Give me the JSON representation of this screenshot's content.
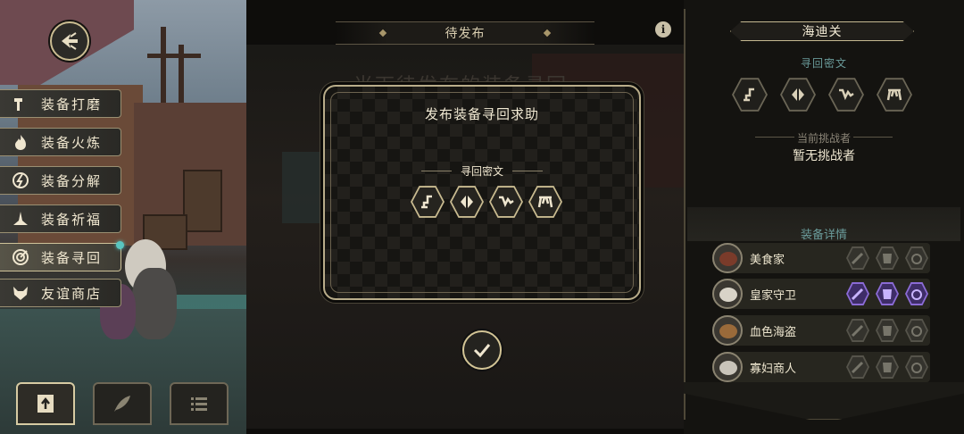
{
  "sidebar": {
    "items": [
      {
        "label": "装备打磨",
        "icon": "hammer-icon"
      },
      {
        "label": "装备火炼",
        "icon": "flame-icon"
      },
      {
        "label": "装备分解",
        "icon": "disassemble-icon"
      },
      {
        "label": "装备祈福",
        "icon": "pray-icon"
      },
      {
        "label": "装备寻回",
        "icon": "target-icon",
        "active": true
      },
      {
        "label": "友谊商店",
        "icon": "fox-icon"
      }
    ],
    "back_icon": "back-arrow-icon",
    "bottom_buttons": [
      {
        "icon": "upload-icon",
        "selected": true
      },
      {
        "icon": "feather-icon",
        "selected": false
      },
      {
        "icon": "list-icon",
        "selected": false
      }
    ]
  },
  "center": {
    "tab_label": "待发布",
    "faded_heading": "当下待发布的装备寻回",
    "info_glyph": "i"
  },
  "dialog": {
    "title": "发布装备寻回求助",
    "cipher_label": "寻回密文",
    "glyph_icons": [
      "rune-1-icon",
      "rune-2-icon",
      "rune-3-icon",
      "rune-4-icon"
    ],
    "confirm_icon": "checkmark-icon"
  },
  "right_panel": {
    "location": "海迪关",
    "cipher_label": "寻回密文",
    "challenger_label": "当前挑战者",
    "challenger_value": "暂无挑战者",
    "details_label": "装备详情",
    "equipment": [
      {
        "name": "美食家",
        "avatar_color": "#7a3b2a",
        "slots": [
          "gray",
          "gray",
          "gray"
        ]
      },
      {
        "name": "皇家守卫",
        "avatar_color": "#d8d3c8",
        "slots": [
          "purple",
          "purple",
          "purple"
        ]
      },
      {
        "name": "血色海盗",
        "avatar_color": "#9a6a3a",
        "slots": [
          "gray",
          "gray",
          "gray"
        ]
      },
      {
        "name": "寡妇商人",
        "avatar_color": "#c9c4ba",
        "slots": [
          "gray",
          "gray",
          "gray"
        ]
      }
    ]
  }
}
